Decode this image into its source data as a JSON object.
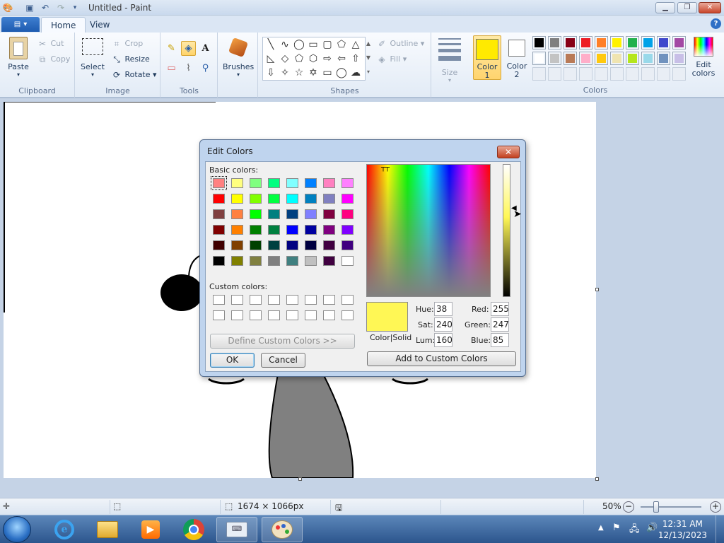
{
  "window": {
    "title": "Untitled - Paint"
  },
  "tabs": {
    "home": "Home",
    "view": "View"
  },
  "clipboard": {
    "paste": "Paste",
    "cut": "Cut",
    "copy": "Copy",
    "label": "Clipboard"
  },
  "image": {
    "select": "Select",
    "crop": "Crop",
    "resize": "Resize",
    "rotate": "Rotate",
    "label": "Image"
  },
  "tools": {
    "label": "Tools"
  },
  "brushes": {
    "label": "Brushes"
  },
  "shapes": {
    "outline": "Outline",
    "fill": "Fill",
    "label": "Shapes"
  },
  "size": {
    "label": "Size"
  },
  "colors": {
    "color1": "Color 1",
    "color2": "Color 2",
    "edit": "Edit colors",
    "label": "Colors",
    "color1_value": "#ffea00",
    "color2_value": "#ffffff",
    "palette_row1": [
      "#000000",
      "#7f7f7f",
      "#880015",
      "#ed1c24",
      "#ff7f27",
      "#fff200",
      "#22b14c",
      "#00a2e8",
      "#3f48cc",
      "#a349a4"
    ],
    "palette_row2": [
      "#ffffff",
      "#c3c3c3",
      "#b97a57",
      "#ffaec9",
      "#ffc90e",
      "#efe4b0",
      "#b5e61d",
      "#99d9ea",
      "#7092be",
      "#c8bfe7"
    ]
  },
  "status": {
    "dimensions": "1674 × 1066px",
    "zoom": "50%"
  },
  "clock": {
    "time": "12:31 AM",
    "date": "12/13/2023"
  },
  "dialog": {
    "title": "Edit Colors",
    "basic_label": "Basic colors:",
    "custom_label": "Custom colors:",
    "define_button": "Define Custom Colors >>",
    "ok": "OK",
    "cancel": "Cancel",
    "add_button": "Add to Custom Colors",
    "color_solid": "Color|Solid",
    "hue_label": "Hue:",
    "hue": "38",
    "sat_label": "Sat:",
    "sat": "240",
    "lum_label": "Lum:",
    "lum": "160",
    "red_label": "Red:",
    "red": "255",
    "green_label": "Green:",
    "green": "247",
    "blue_label": "Blue:",
    "blue": "85",
    "preview_color": "#fff755",
    "basic_colors": [
      [
        "#ff8080",
        "#ffff80",
        "#80ff80",
        "#00ff80",
        "#80ffff",
        "#0080ff",
        "#ff80c0",
        "#ff80ff"
      ],
      [
        "#ff0000",
        "#ffff00",
        "#80ff00",
        "#00ff40",
        "#00ffff",
        "#0080c0",
        "#8080c0",
        "#ff00ff"
      ],
      [
        "#804040",
        "#ff8040",
        "#00ff00",
        "#008080",
        "#004080",
        "#8080ff",
        "#800040",
        "#ff0080"
      ],
      [
        "#800000",
        "#ff8000",
        "#008000",
        "#008040",
        "#0000ff",
        "#0000a0",
        "#800080",
        "#8000ff"
      ],
      [
        "#400000",
        "#804000",
        "#004000",
        "#004040",
        "#000080",
        "#000040",
        "#400040",
        "#400080"
      ],
      [
        "#000000",
        "#808000",
        "#808040",
        "#808080",
        "#408080",
        "#c0c0c0",
        "#400040",
        "#ffffff"
      ]
    ]
  }
}
